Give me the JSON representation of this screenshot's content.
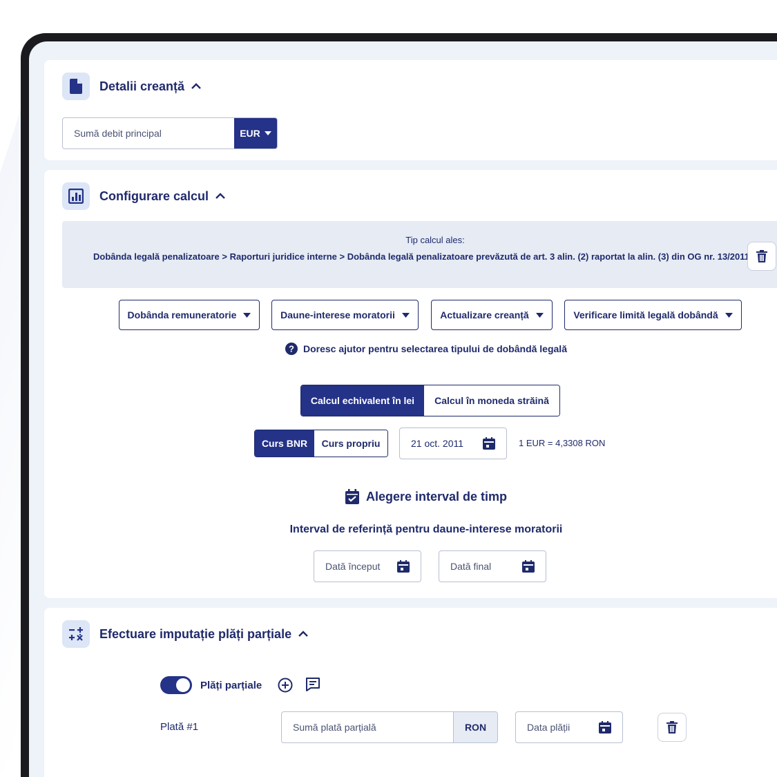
{
  "sections": {
    "claim": {
      "title": "Detalii creanță",
      "amount_placeholder": "Sumă debit principal",
      "currency": "EUR"
    },
    "config": {
      "title": "Configurare calcul",
      "tip_label": "Tip calcul ales:",
      "tip_path": "Dobânda legală penalizatoare > Raporturi juridice interne > Dobânda legală penalizatoare prevăzută de art. 3 alin. (2) raportat la alin. (3) din OG nr. 13/2011",
      "dropdowns": [
        "Dobânda remuneratorie",
        "Daune-interese moratorii",
        "Actualizare creanță",
        "Verificare limită legală dobândă"
      ],
      "help_text": "Doresc ajutor pentru selectarea tipului de dobândă legală",
      "calc_options": [
        "Calcul echivalent în lei",
        "Calcul în moneda străină"
      ],
      "rate_options": [
        "Curs BNR",
        "Curs propriu"
      ],
      "rate_date": "21 oct. 2011",
      "rate_value": "1 EUR = 4,3308 RON",
      "interval_title": "Alegere interval de timp",
      "interval_subtitle": "Interval de referință pentru daune-interese moratorii",
      "start_date_placeholder": "Dată început",
      "end_date_placeholder": "Dată final"
    },
    "partial": {
      "title": "Efectuare imputație plăți parțiale",
      "toggle_label": "Plăți parțiale",
      "payment_label": "Plată #1",
      "amount_placeholder": "Sumă plată parțială",
      "currency": "RON",
      "date_placeholder": "Data plății"
    }
  },
  "colors": {
    "primary": "#243287",
    "text": "#1f2a6b",
    "panel": "#e6ebf4",
    "icon_bg": "#dde6f6"
  },
  "icons": [
    "document-icon",
    "chart-icon",
    "calculator-icon",
    "chevron-up-icon",
    "caret-down-icon",
    "trash-icon",
    "help-icon",
    "calendar-icon",
    "calendar-check-icon",
    "plus-circle-icon",
    "comment-icon"
  ]
}
